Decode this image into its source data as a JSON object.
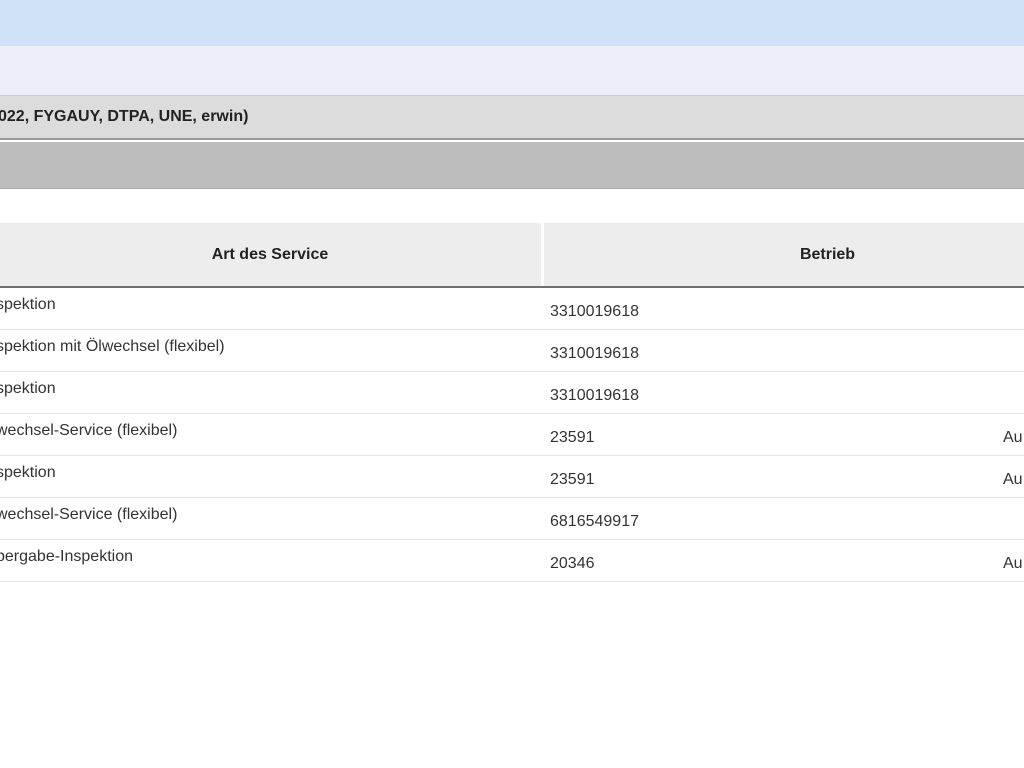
{
  "header": {
    "info_text": "022, FYGAUY, DTPA, UNE, erwin)"
  },
  "table": {
    "columns": [
      "Art des Service",
      "Betrieb"
    ],
    "rows": [
      {
        "service": "spektion",
        "betrieb": "3310019618",
        "extra": ""
      },
      {
        "service": "spektion mit Ölwechsel (flexibel)",
        "betrieb": "3310019618",
        "extra": ""
      },
      {
        "service": "spektion",
        "betrieb": "3310019618",
        "extra": ""
      },
      {
        "service": "wechsel-Service (flexibel)",
        "betrieb": "23591",
        "extra": "Au"
      },
      {
        "service": "spektion",
        "betrieb": "23591",
        "extra": "Au"
      },
      {
        "service": "wechsel-Service (flexibel)",
        "betrieb": "6816549917",
        "extra": ""
      },
      {
        "service": "bergabe-Inspektion",
        "betrieb": "20346",
        "extra": "Au"
      }
    ]
  }
}
